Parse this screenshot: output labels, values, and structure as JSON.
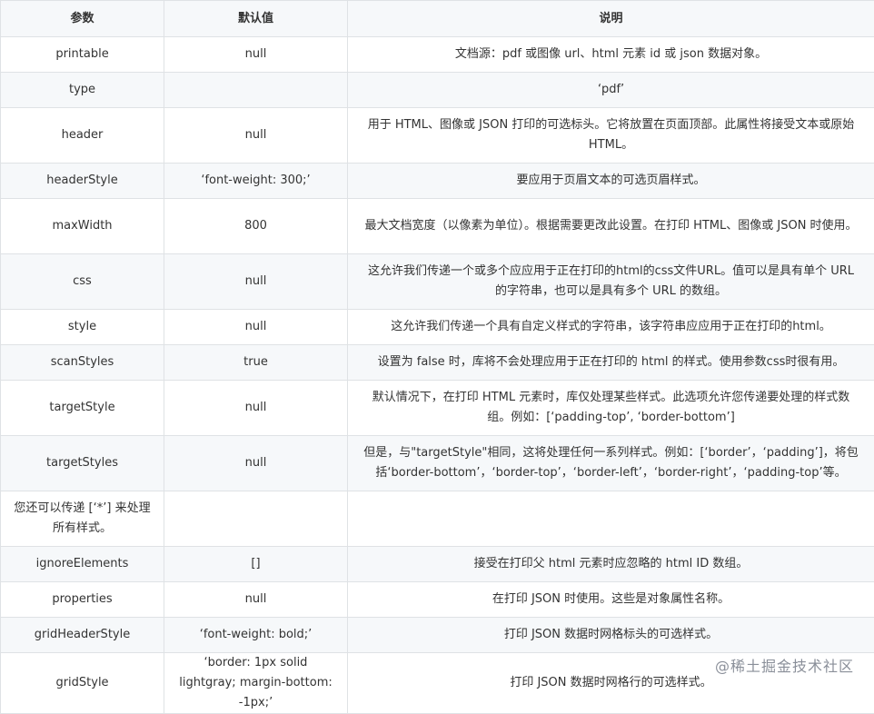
{
  "headers": {
    "param": "参数",
    "default": "默认值",
    "desc": "说明"
  },
  "rows": [
    {
      "param": "printable",
      "default": "null",
      "desc": "文档源：pdf 或图像 url、html 元素 id 或 json 数据对象。"
    },
    {
      "param": "type",
      "default": "",
      "desc": "‘pdf’"
    },
    {
      "param": "header",
      "default": "null",
      "desc": "用于 HTML、图像或 JSON 打印的可选标头。它将放置在页面顶部。此属性将接受文本或原始 HTML。"
    },
    {
      "param": "headerStyle",
      "default": "‘font-weight: 300;’",
      "desc": "要应用于页眉文本的可选页眉样式。"
    },
    {
      "param": "maxWidth",
      "default": "800",
      "desc": "最大文档宽度（以像素为单位）。根据需要更改此设置。在打印 HTML、图像或 JSON 时使用。"
    },
    {
      "param": "css",
      "default": "null",
      "desc": "这允许我们传递一个或多个应应用于正在打印的html的css文件URL。值可以是具有单个 URL 的字符串，也可以是具有多个 URL 的数组。"
    },
    {
      "param": "style",
      "default": "null",
      "desc": "这允许我们传递一个具有自定义样式的字符串，该字符串应应用于正在打印的html。"
    },
    {
      "param": "scanStyles",
      "default": "true",
      "desc": "设置为 false 时，库将不会处理应用于正在打印的 html 的样式。使用参数css时很有用。"
    },
    {
      "param": "targetStyle",
      "default": "null",
      "desc": "默认情况下，在打印 HTML 元素时，库仅处理某些样式。此选项允许您传递要处理的样式数组。例如：[‘padding-top’, ‘border-bottom’]"
    },
    {
      "param": "targetStyles",
      "default": "null",
      "desc": "但是，与\"targetStyle\"相同，这将处理任何一系列样式。例如：[‘border’，‘padding’]，将包括‘border-bottom’，‘border-top’，‘border-left’，‘border-right’，‘padding-top’等。"
    },
    {
      "param": "您还可以传递 [‘*’] 来处理所有样式。",
      "default": "",
      "desc": ""
    },
    {
      "param": "ignoreElements",
      "default": "[]",
      "desc": "接受在打印父 html 元素时应忽略的 html ID 数组。"
    },
    {
      "param": "properties",
      "default": "null",
      "desc": "在打印 JSON 时使用。这些是对象属性名称。"
    },
    {
      "param": "gridHeaderStyle",
      "default": "‘font-weight: bold;’",
      "desc": "打印 JSON 数据时网格标头的可选样式。"
    },
    {
      "param": "gridStyle",
      "default": "‘border: 1px solid lightgray; margin-bottom: -1px;’",
      "desc": "打印 JSON 数据时网格行的可选样式。"
    }
  ],
  "watermark": "@稀土掘金技术社区"
}
